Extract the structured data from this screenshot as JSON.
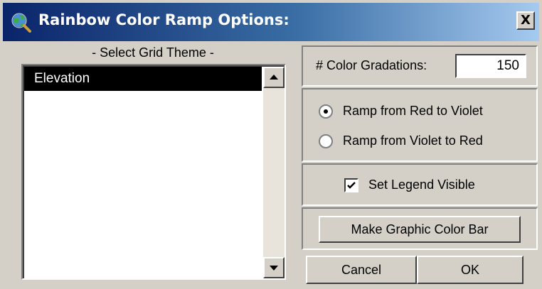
{
  "window": {
    "title": "Rainbow Color Ramp Options:",
    "close_glyph": "X",
    "title_icon": "globe-magnifier-icon",
    "title_bar_color": "#0a246a"
  },
  "grid_theme": {
    "label": "- Select Grid Theme -",
    "items": [
      "Elevation"
    ],
    "selected_index": 0
  },
  "gradations": {
    "label": "# Color Gradations:",
    "value": "150"
  },
  "ramp": {
    "options": [
      "Ramp from Red to Violet",
      "Ramp from Violet to Red"
    ],
    "selected_index": 0
  },
  "legend": {
    "label": "Set Legend Visible",
    "checked": true
  },
  "buttons": {
    "colorbar": "Make Graphic Color Bar",
    "cancel": "Cancel",
    "ok": "OK"
  }
}
